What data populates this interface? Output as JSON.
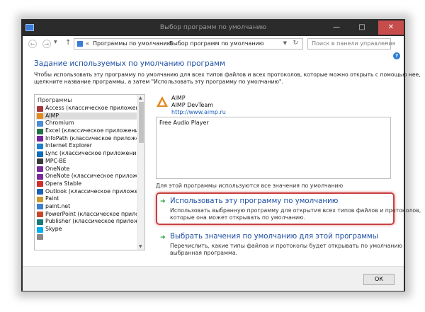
{
  "window": {
    "title": "Выбор программ по умолчанию",
    "minimize": "—",
    "maximize": "□",
    "close": "✕"
  },
  "nav": {
    "back": "←",
    "forward": "→",
    "up": "↑",
    "address_sep": "«",
    "breadcrumbs": [
      "Программы по умолчанию",
      "Выбор программ по умолчанию"
    ],
    "breadcrumb_sep": "›",
    "search_placeholder": "Поиск в панели управления"
  },
  "help": "?",
  "heading": "Задание используемых по умолчанию программ",
  "description": [
    "Чтобы использовать эту программу по умолчанию для всех типов файлов и всех протоколов, которые можно открыть с помощью нее,",
    "щелкните название программы, а затем \"Использовать эту программу по умолчанию\"."
  ],
  "programs": {
    "header": "Программы",
    "items": [
      {
        "label": "Access (классическое приложение)",
        "icon_color": "#a4373a"
      },
      {
        "label": "AIMP",
        "icon_color": "#e38a1f",
        "selected": true
      },
      {
        "label": "Chromium",
        "icon_color": "#4a8cd8"
      },
      {
        "label": "Excel (классическое приложение)",
        "icon_color": "#207245"
      },
      {
        "label": "InfoPath (классическое приложение)",
        "icon_color": "#77219a"
      },
      {
        "label": "Internet Explorer",
        "icon_color": "#1e7fd0"
      },
      {
        "label": "Lync (классическое приложение)",
        "icon_color": "#0a6ebd"
      },
      {
        "label": "MPC-BE",
        "icon_color": "#3a3a3a"
      },
      {
        "label": "OneNote",
        "icon_color": "#7a2a9a"
      },
      {
        "label": "OneNote (классическое приложение)",
        "icon_color": "#7a2a9a"
      },
      {
        "label": "Opera Stable",
        "icon_color": "#d12b2b"
      },
      {
        "label": "Outlook (классическое приложение)",
        "icon_color": "#1a62b5"
      },
      {
        "label": "Paint",
        "icon_color": "#c99a2e"
      },
      {
        "label": "paint.net",
        "icon_color": "#3d7ecf"
      },
      {
        "label": "PowerPoint (классическое приложение)",
        "icon_color": "#c8462a"
      },
      {
        "label": "Publisher (классическое приложение)",
        "icon_color": "#1a7a7a"
      },
      {
        "label": "Skype",
        "icon_color": "#00aff0"
      },
      {
        "label": "",
        "icon_color": "#888888"
      }
    ]
  },
  "selected_app": {
    "name": "AIMP",
    "publisher": "AIMP DevTeam",
    "url": "http://www.aimp.ru",
    "description": "Free Audio Player",
    "defaults_text": "Для этой программы используются все значения по умолчанию"
  },
  "options": [
    {
      "title": "Использовать эту программу по умолчанию",
      "desc": [
        "Использовать выбранную программу для открытия всех типов файлов и протоколов,",
        "которые она может открывать по умолчанию."
      ]
    },
    {
      "title": "Выбрать значения по умолчанию для этой программы",
      "desc": [
        "Перечислить, какие типы файлов и протоколы будет открывать по умолчанию",
        "выбранная программа."
      ]
    }
  ],
  "ok_label": "ОК",
  "colors": {
    "accent": "#1e4fa3",
    "highlight": "#c94040",
    "arrow": "#1f9d3a"
  }
}
